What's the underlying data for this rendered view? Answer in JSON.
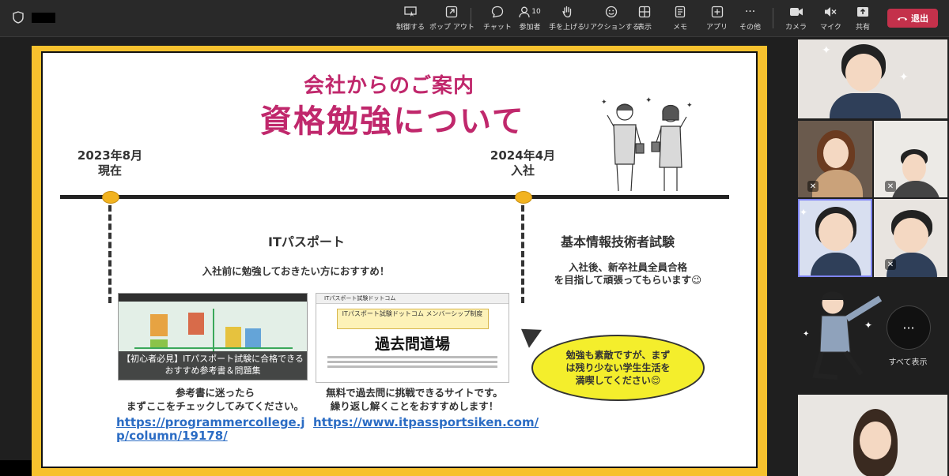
{
  "toolbar": {
    "buttons": [
      {
        "label": "制御する",
        "icon": "control-icon"
      },
      {
        "label": "ポップ アウト",
        "icon": "popout-icon"
      },
      {
        "label": "チャット",
        "icon": "chat-icon"
      },
      {
        "label": "参加者",
        "icon": "people-icon",
        "count": "10"
      },
      {
        "label": "手を上げる",
        "icon": "raise-hand-icon"
      },
      {
        "label": "リアクションする",
        "icon": "reaction-icon"
      },
      {
        "label": "表示",
        "icon": "view-icon"
      },
      {
        "label": "メモ",
        "icon": "notes-icon"
      },
      {
        "label": "アプリ",
        "icon": "apps-icon"
      },
      {
        "label": "その他",
        "icon": "more-icon"
      },
      {
        "label": "カメラ",
        "icon": "camera-icon"
      },
      {
        "label": "マイク",
        "icon": "mic-off-icon"
      },
      {
        "label": "共有",
        "icon": "share-icon"
      }
    ],
    "leave_label": "退出",
    "leave_color": "#c4314b"
  },
  "slide": {
    "title_small": "会社からのご案内",
    "title_large": "資格勉強について",
    "left_date": {
      "line1": "2023年8月",
      "line2": "現在"
    },
    "right_date": {
      "line1": "2024年4月",
      "line2": "入社"
    },
    "it_passport": {
      "title": "ITパスポート",
      "subtitle": "入社前に勉強しておきたい方におすすめ！"
    },
    "kihon": {
      "title": "基本情報技術者試験",
      "line1": "入社後、新卒社員全員合格",
      "line2": "を目指して頑張ってもらいます😉"
    },
    "thumb1": {
      "header": "【初心者必見】ITパスポート試験に合格できるおすすめ参考書＆問題集",
      "caption": "【初心者必見】ITパスポート試験に合格できる おすすめ参考書＆問題集"
    },
    "thumb2": {
      "header": "ITパスポート試験ドットコム",
      "band": "ITパスポート試験ドットコム メンバーシップ制度",
      "big": "過去問道場"
    },
    "book_desc": {
      "line1": "参考書に迷ったら",
      "line2": "まずここをチェックしてみてください。"
    },
    "site_desc": {
      "line1": "無料で過去問に挑戦できるサイトです。",
      "line2": "繰り返し解くことをおすすめします！"
    },
    "link1": {
      "line1": "https://programmercollege.j",
      "line2": "p/column/19178/"
    },
    "link2": "https://www.itpassportsiken.com/",
    "bubble": {
      "line1": "勉強も素敵ですが、まず",
      "line2": "は残り少ない学生生活を",
      "line3": "満喫してください😌"
    }
  },
  "participants": {
    "more_label": "···",
    "show_all_label": "すべて表示"
  }
}
